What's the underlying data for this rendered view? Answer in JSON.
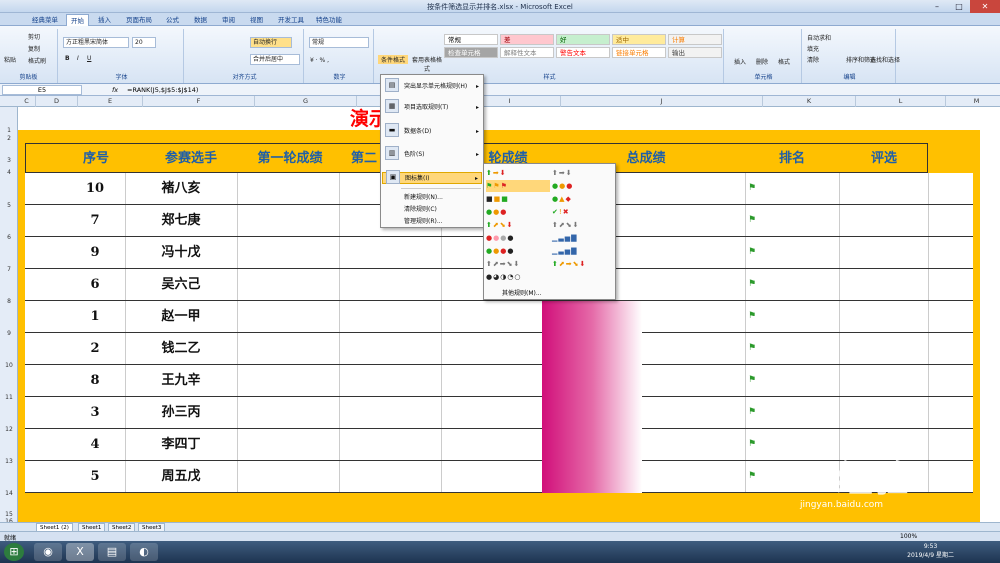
{
  "window": {
    "title": "按条件筛选显示并排名.xlsx - Microsoft Excel"
  },
  "tabs": [
    "经典菜单",
    "开始",
    "插入",
    "页面布局",
    "公式",
    "数据",
    "审阅",
    "视图",
    "开发工具",
    "特色功能"
  ],
  "ribbon": {
    "clipboard": {
      "label": "剪贴板",
      "paste": "粘贴",
      "cut": "剪切",
      "copy": "复制",
      "format_painter": "格式刷"
    },
    "font": {
      "label": "字体",
      "name": "方正粗黑宋简体",
      "size": "20"
    },
    "alignment": {
      "label": "对齐方式",
      "wrap": "自动换行",
      "merge": "合并后居中"
    },
    "number": {
      "label": "数字",
      "format": "常规"
    },
    "styles": {
      "label": "样式",
      "cond_format": "条件格式",
      "table_format": "套用表格格式",
      "cells": [
        {
          "text": "常规",
          "bg": "#ffffff",
          "fg": "#000000"
        },
        {
          "text": "差",
          "bg": "#ffc7ce",
          "fg": "#9c0006"
        },
        {
          "text": "好",
          "bg": "#c6efce",
          "fg": "#006100"
        },
        {
          "text": "适中",
          "bg": "#ffeb9c",
          "fg": "#9c6500"
        },
        {
          "text": "计算",
          "bg": "#f2f2f2",
          "fg": "#fa7d00"
        },
        {
          "text": "检查单元格",
          "bg": "#a5a5a5",
          "fg": "#ffffff"
        },
        {
          "text": "解释性文本",
          "bg": "#ffffff",
          "fg": "#7f7f7f"
        },
        {
          "text": "警告文本",
          "bg": "#ffffff",
          "fg": "#ff0000"
        },
        {
          "text": "链接单元格",
          "bg": "#ffffff",
          "fg": "#fa7d00"
        },
        {
          "text": "输出",
          "bg": "#f2f2f2",
          "fg": "#3f3f3f"
        }
      ]
    },
    "cells_group": {
      "label": "单元格",
      "insert": "插入",
      "delete": "删除",
      "format": "格式"
    },
    "editing": {
      "label": "编辑",
      "autosum": "自动求和",
      "fill": "填充",
      "clear": "清除",
      "sort": "排序和筛选",
      "find": "查找和选择"
    }
  },
  "formula_bar": {
    "cell": "E5",
    "fx": "fx",
    "formula": "=RANK(J5,$J$5:$J$14)"
  },
  "columns": [
    "C",
    "D",
    "E",
    "F",
    "G",
    "H",
    "I",
    "J",
    "K",
    "L",
    "M"
  ],
  "rows": [
    "1",
    "2",
    "3",
    "4",
    "5",
    "6",
    "7",
    "8",
    "9",
    "10",
    "11",
    "12",
    "13",
    "14",
    "15",
    "16"
  ],
  "sheet_title": "演示示例样表",
  "headers": [
    "序号",
    "参赛选手",
    "第一轮成绩",
    "第二",
    "轮成绩",
    "总成绩",
    "排名",
    "评选"
  ],
  "table": [
    {
      "no": "10",
      "name": "褚八亥"
    },
    {
      "no": "7",
      "name": "郑七庚"
    },
    {
      "no": "9",
      "name": "冯十戊"
    },
    {
      "no": "6",
      "name": "吴六己"
    },
    {
      "no": "1",
      "name": "赵一甲"
    },
    {
      "no": "2",
      "name": "钱二乙"
    },
    {
      "no": "8",
      "name": "王九辛"
    },
    {
      "no": "3",
      "name": "孙三丙"
    },
    {
      "no": "4",
      "name": "李四丁"
    },
    {
      "no": "5",
      "name": "周五戊"
    }
  ],
  "menu": {
    "items": [
      "突出显示单元格规则(H)",
      "项目选取规则(T)",
      "数据条(D)",
      "色阶(S)",
      "图标集(I)"
    ],
    "extra": [
      "新建规则(N)...",
      "清除规则(C)",
      "管理规则(R)..."
    ],
    "more_rules": "其他规则(M)..."
  },
  "sheets": [
    "Sheet1 (2)",
    "Sheet1",
    "Sheet2",
    "Sheet3"
  ],
  "status": {
    "ready": "就绪",
    "zoom": "100%"
  },
  "clock": {
    "time": "9:53",
    "date": "2019/4/9 星期二"
  },
  "watermark": {
    "brand": "Bai 经验",
    "url": "jingyan.baidu.com"
  }
}
